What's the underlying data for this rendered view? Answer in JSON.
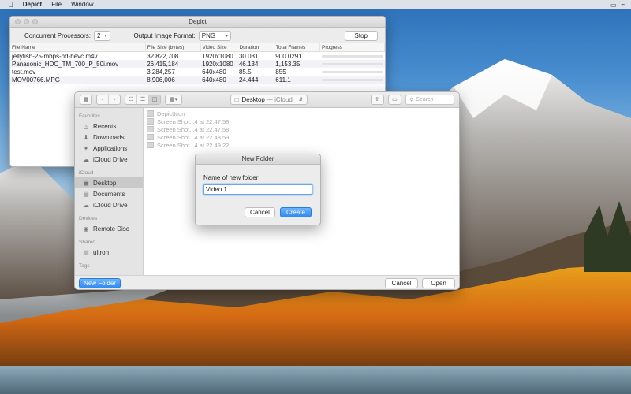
{
  "menubar": {
    "app_name": "Depict",
    "items": [
      "File",
      "Window"
    ]
  },
  "depict": {
    "title": "Depict",
    "processors_label": "Concurrent Processors:",
    "processors_value": "2",
    "format_label": "Output Image Format:",
    "format_value": "PNG",
    "stop_label": "Stop",
    "columns": [
      "File Name",
      "File Size (bytes)",
      "Video Size",
      "Duration",
      "Total Frames",
      "Progress"
    ],
    "rows": [
      {
        "name": "jellyfish-25-mbps-hd-hevc.m4v",
        "size": "32,822,708",
        "video": "1920x1080",
        "duration": "30.031",
        "frames": "900.0291"
      },
      {
        "name": "Panasonic_HDC_TM_700_P_50i.mov",
        "size": "26,415,184",
        "video": "1920x1080",
        "duration": "46.134",
        "frames": "1,153.35"
      },
      {
        "name": "test.mov",
        "size": "3,284,257",
        "video": "640x480",
        "duration": "85.5",
        "frames": "855"
      },
      {
        "name": "MOV00766.MPG",
        "size": "8,906,006",
        "video": "640x480",
        "duration": "24.444",
        "frames": "611.1"
      }
    ]
  },
  "savepanel": {
    "location": "Desktop",
    "location_sub": "— iCloud",
    "search_placeholder": "Search",
    "sidebar": {
      "favorites_header": "Favorites",
      "favorites": [
        {
          "label": "Recents",
          "icon": "clock-icon"
        },
        {
          "label": "Downloads",
          "icon": "download-icon"
        },
        {
          "label": "Applications",
          "icon": "applications-icon"
        },
        {
          "label": "iCloud Drive",
          "icon": "cloud-icon"
        }
      ],
      "icloud_header": "iCloud",
      "icloud": [
        {
          "label": "Desktop",
          "icon": "desktop-icon"
        },
        {
          "label": "Documents",
          "icon": "document-icon"
        },
        {
          "label": "iCloud Drive",
          "icon": "cloud-icon"
        }
      ],
      "devices_header": "Devices",
      "devices": [
        {
          "label": "Remote Disc",
          "icon": "disc-icon"
        }
      ],
      "shared_header": "Shared",
      "shared": [
        {
          "label": "ultron",
          "icon": "computer-icon"
        }
      ],
      "tags_header": "Tags"
    },
    "files": [
      "DepictIcon",
      "Screen Shot...4 at 22.47.58",
      "Screen Shot...4 at 22.47.58",
      "Screen Shot...4 at 22.48.59",
      "Screen Shot...4 at 22.49.22"
    ],
    "new_folder_button": "New Folder",
    "cancel_button": "Cancel",
    "open_button": "Open"
  },
  "newfolder": {
    "title": "New Folder",
    "prompt": "Name of new folder:",
    "value": "Video 1",
    "cancel": "Cancel",
    "create": "Create"
  }
}
